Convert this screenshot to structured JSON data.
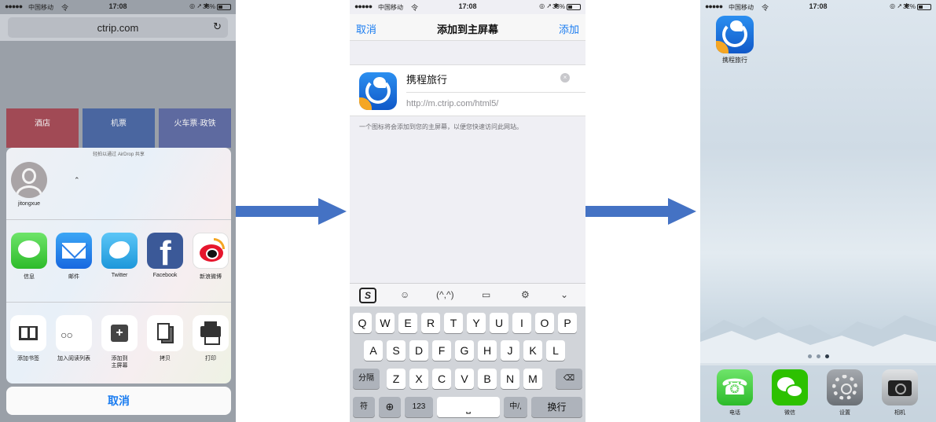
{
  "status_bar": {
    "signal": "●●●●●",
    "carrier": "中国移动",
    "wifi": "令",
    "time": "17:08",
    "icons": "◎ ➚ ✱",
    "battery_p1": "33%",
    "battery_p2": "33%",
    "battery_p3": "32%"
  },
  "screen1": {
    "url": "ctrip.com",
    "tiles": [
      "酒店",
      "机票",
      "火车票·政铁"
    ],
    "airdrop_hint": "轻拍以通过 AirDrop 共享",
    "contact_name": "jitongxue",
    "share_apps": [
      {
        "label": "信息",
        "icon": "messages-icon"
      },
      {
        "label": "邮件",
        "icon": "mail-icon"
      },
      {
        "label": "Twitter",
        "icon": "twitter-icon"
      },
      {
        "label": "Facebook",
        "icon": "facebook-icon"
      },
      {
        "label": "新浪微博",
        "icon": "weibo-icon"
      }
    ],
    "actions": [
      {
        "label": "添加书签",
        "icon": "bookmark-icon"
      },
      {
        "label": "加入阅读列表",
        "icon": "reading-list-icon"
      },
      {
        "label": "添加到\n主屏幕",
        "icon": "add-home-icon"
      },
      {
        "label": "拷贝",
        "icon": "copy-icon"
      },
      {
        "label": "打印",
        "icon": "print-icon"
      }
    ],
    "cancel": "取消"
  },
  "screen2": {
    "nav_left": "取消",
    "nav_title": "添加到主屏幕",
    "nav_right": "添加",
    "app_name": "携程旅行",
    "app_url": "http://m.ctrip.com/html5/",
    "hint": "一个图标将会添加到您的主屏幕，以便您快速访问此网站。",
    "keyboard": {
      "row1": [
        "Q",
        "W",
        "E",
        "R",
        "T",
        "Y",
        "U",
        "I",
        "O",
        "P"
      ],
      "row2": [
        "A",
        "S",
        "D",
        "F",
        "G",
        "H",
        "J",
        "K",
        "L"
      ],
      "row3": [
        "Z",
        "X",
        "C",
        "V",
        "B",
        "N",
        "M"
      ],
      "shift": "分隔",
      "symbols": "符",
      "num": "123",
      "space": "⎵",
      "lang": "中/,",
      "return": "换行",
      "globe": "⊕",
      "delete": "⌫"
    },
    "candidates": [
      "☺",
      "(^,^)",
      "▭",
      "⚙",
      "⌄"
    ],
    "ime_logo": "S"
  },
  "screen3": {
    "home_app": "携程旅行",
    "dock": [
      {
        "label": "电话",
        "icon": "phone-icon"
      },
      {
        "label": "微信",
        "icon": "wechat-icon"
      },
      {
        "label": "设置",
        "icon": "settings-icon"
      },
      {
        "label": "相机",
        "icon": "camera-icon"
      }
    ],
    "battery_level": 0.32
  },
  "colors": {
    "ios_blue": "#1a7cf0",
    "arrow": "#4472c4"
  }
}
